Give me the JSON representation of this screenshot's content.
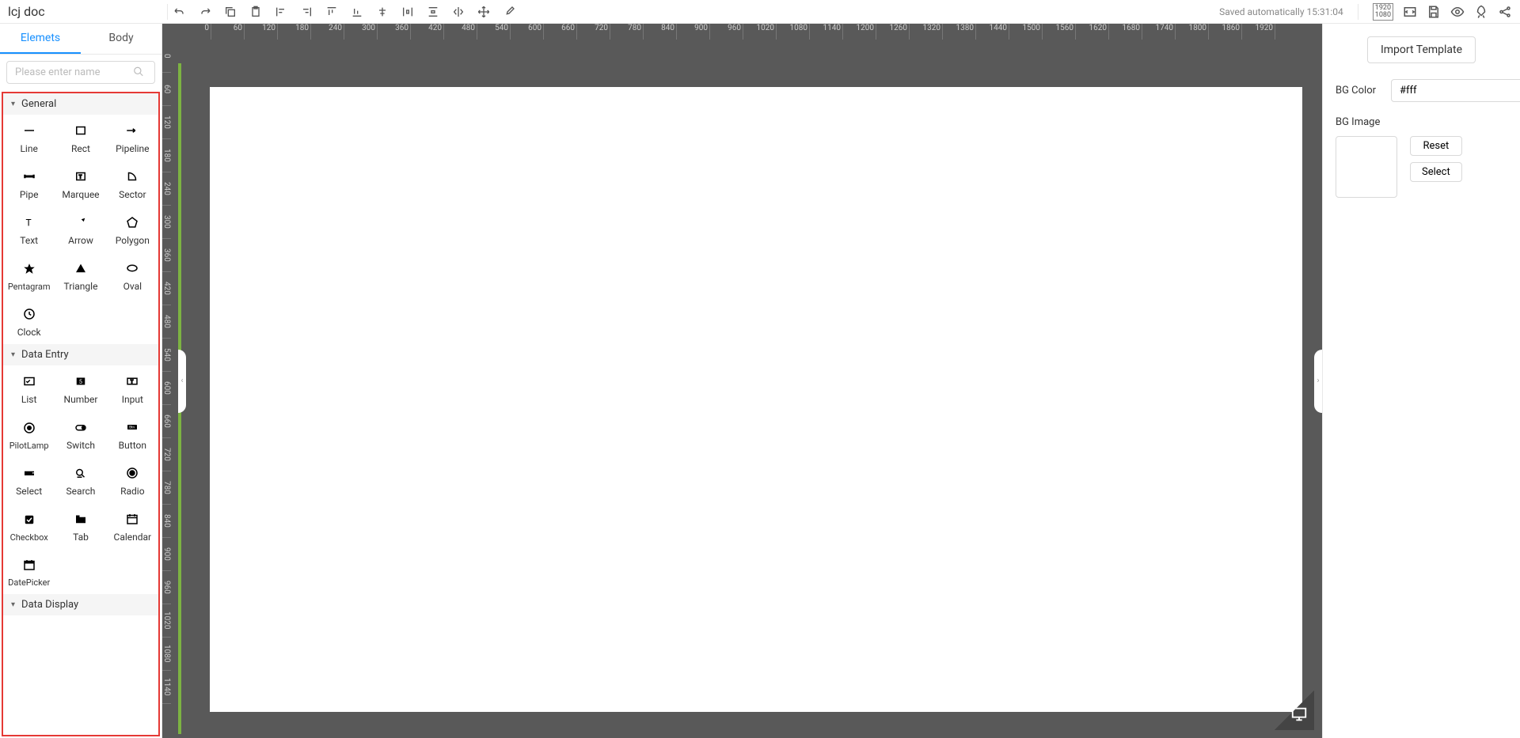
{
  "topbar": {
    "title": "lcj doc",
    "save_status": "Saved automatically 15:31:04",
    "dim_badge": "1920\n1080"
  },
  "sidebar": {
    "tabs": [
      "Elemets",
      "Body"
    ],
    "search_placeholder": "Please enter name",
    "groups": [
      {
        "title": "General",
        "items": [
          "Line",
          "Rect",
          "Pipeline",
          "Pipe",
          "Marquee",
          "Sector",
          "Text",
          "Arrow",
          "Polygon",
          "Pentagram",
          "Triangle",
          "Oval",
          "Clock"
        ]
      },
      {
        "title": "Data Entry",
        "items": [
          "List",
          "Number",
          "Input",
          "PilotLamp",
          "Switch",
          "Button",
          "Select",
          "Search",
          "Radio",
          "Checkbox",
          "Tab",
          "Calendar",
          "DatePicker"
        ]
      },
      {
        "title": "Data Display",
        "items": []
      }
    ]
  },
  "ruler_h": [
    "0",
    "60",
    "120",
    "180",
    "240",
    "300",
    "360",
    "420",
    "480",
    "540",
    "600",
    "660",
    "720",
    "780",
    "840",
    "900",
    "960",
    "1020",
    "1080",
    "1140",
    "1200",
    "1260",
    "1320",
    "1380",
    "1440",
    "1500",
    "1560",
    "1620",
    "1680",
    "1740",
    "1800",
    "1860",
    "1920"
  ],
  "ruler_v": [
    "0",
    "60",
    "120",
    "180",
    "240",
    "300",
    "360",
    "420",
    "480",
    "540",
    "600",
    "660",
    "720",
    "780",
    "840",
    "900",
    "960",
    "1020",
    "1080",
    "1140"
  ],
  "right": {
    "import_btn": "Import Template",
    "bg_color_label": "BG Color",
    "bg_color_value": "#fff",
    "bg_image_label": "BG Image",
    "reset_btn": "Reset",
    "select_btn": "Select"
  }
}
